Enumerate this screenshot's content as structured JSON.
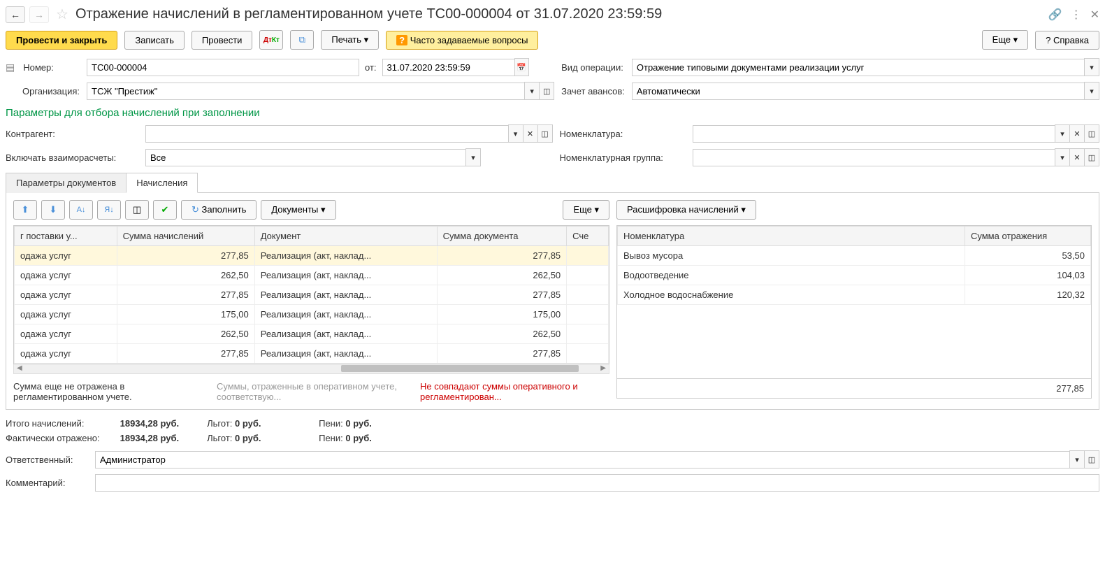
{
  "header": {
    "title": "Отражение начислений в регламентированном учете ТС00-000004 от 31.07.2020 23:59:59"
  },
  "toolbar": {
    "post_close": "Провести и закрыть",
    "save": "Записать",
    "post": "Провести",
    "print": "Печать",
    "faq": "Часто задаваемые вопросы",
    "more": "Еще",
    "help": "Справка"
  },
  "form": {
    "number_label": "Номер:",
    "number": "ТС00-000004",
    "date_label": "от:",
    "date": "31.07.2020 23:59:59",
    "op_type_label": "Вид операции:",
    "op_type": "Отражение типовыми документами реализации услуг",
    "org_label": "Организация:",
    "org": "ТСЖ \"Престиж\"",
    "advance_label": "Зачет авансов:",
    "advance": "Автоматически"
  },
  "section_title": "Параметры для отбора начислений при заполнении",
  "filters": {
    "contragent_label": "Контрагент:",
    "include_label": "Включать взаиморасчеты:",
    "include_value": "Все",
    "nomenclature_label": "Номенклатура:",
    "nom_group_label": "Номенклатурная группа:"
  },
  "tabs": {
    "params": "Параметры документов",
    "charges": "Начисления"
  },
  "left_toolbar": {
    "fill": "Заполнить",
    "documents": "Документы",
    "more": "Еще"
  },
  "right_toolbar": {
    "decode": "Расшифровка начислений"
  },
  "left_table": {
    "headers": [
      "г поставки у...",
      "Сумма начислений",
      "Документ",
      "Сумма документа",
      "Сче"
    ],
    "rows": [
      {
        "c0": "одажа услуг",
        "c1": "277,85",
        "c2": "Реализация (акт, наклад...",
        "c3": "277,85",
        "selected": true
      },
      {
        "c0": "одажа услуг",
        "c1": "262,50",
        "c2": "Реализация (акт, наклад...",
        "c3": "262,50"
      },
      {
        "c0": "одажа услуг",
        "c1": "277,85",
        "c2": "Реализация (акт, наклад...",
        "c3": "277,85"
      },
      {
        "c0": "одажа услуг",
        "c1": "175,00",
        "c2": "Реализация (акт, наклад...",
        "c3": "175,00"
      },
      {
        "c0": "одажа услуг",
        "c1": "262,50",
        "c2": "Реализация (акт, наклад...",
        "c3": "262,50"
      },
      {
        "c0": "одажа услуг",
        "c1": "277,85",
        "c2": "Реализация (акт, наклад...",
        "c3": "277,85"
      }
    ]
  },
  "right_table": {
    "headers": [
      "Номенклатура",
      "Сумма отражения"
    ],
    "rows": [
      {
        "name": "Вывоз мусора",
        "sum": "53,50"
      },
      {
        "name": "Водоотведение",
        "sum": "104,03"
      },
      {
        "name": "Холодное водоснабжение",
        "sum": "120,32"
      }
    ],
    "total": "277,85"
  },
  "legend": {
    "l1": "Сумма еще не отражена в регламентированном учете.",
    "l2": "Суммы, отраженные в оперативном учете, соответствую...",
    "l3": "Не совпадают суммы оперативного и регламентирован..."
  },
  "totals": {
    "total_charges_label": "Итого начислений:",
    "total_charges": "18934,28 руб.",
    "actual_label": "Фактически отражено:",
    "actual": "18934,28 руб.",
    "benefits_label": "Льгот:",
    "benefits": "0 руб.",
    "penalty_label": "Пени:",
    "penalty": "0 руб."
  },
  "footer": {
    "responsible_label": "Ответственный:",
    "responsible": "Администратор",
    "comment_label": "Комментарий:"
  }
}
